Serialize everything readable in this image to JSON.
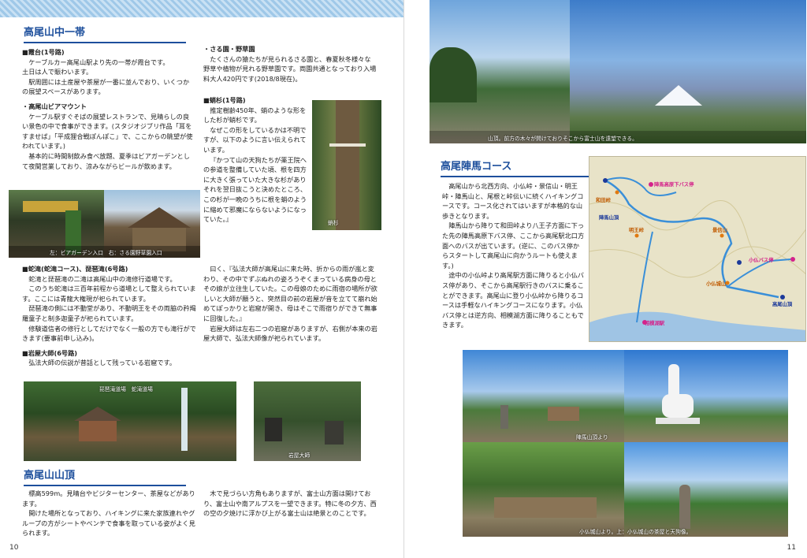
{
  "left": {
    "sec1_title": "高尾山中一帯",
    "col1": {
      "kasumi_head": "■霞台(1号路)",
      "kasumi_1": "ケーブルカー高尾山駅より先の一帯が霞台です。",
      "kasumi_2": "土日は人で賑わいます。",
      "kasumi_3": "駅周囲には土産屋や茶屋が一番に並んでおり、いくつかの展望スペースがあります。",
      "beer_head": "・高尾山ビアマウント",
      "beer_1": "ケーブル駅すぐそばの展望レストランで、見晴らしの良い景色の中で食事ができます。(スタジオジブリ作品「耳をすませば」「平成狸合戦ぽんぽこ」で、ここからの眺望が使われています。)",
      "beer_2": "基本的に時間制飲み食べ放題、夏季はビアガーデンとして夜間営業しており、涼みながらビールが飲めます。"
    },
    "col2": {
      "saru_head": "・さる園・野草園",
      "saru_1": "たくさんの猿たちが見られるさる園と、春夏秋冬様々な野草や植物が見れる野草園です。両園共通となっており入場料大人420円です(2018/8現在)。",
      "tako_head": "■蛸杉(1号路)",
      "tako_1": "推定樹齢450年、蛸のような形をした杉が蛸杉です。",
      "tako_2": "なぜこの形をしているかは不明ですが、以下のように言い伝えられています。",
      "tako_3": "『かつて山の天狗たちが薬王院への参道を整備していた頃、根を四方に大きく張っていた大きな杉がありそれを翌日抜こうと決めたところ、この杉が一晩のうちに根を蛸のように縮めて邪魔にならないようになっていた。』"
    },
    "photo_cablecar_caption": "左：ビアガーデン入口　右：さる園野草園入口",
    "photo_tree_caption": "蛸杉",
    "col3": {
      "jaja_head": "■蛇滝(蛇滝コース)、琵琶滝(6号路)",
      "jaja_1": "蛇滝と琵琶滝の二滝は高尾山中の滝修行道場です。",
      "jaja_2": "このうち蛇滝は三百年前程から道場として整えられています。ここには青龍大権現が祀られています。",
      "jaja_3": "琵琶滝の側には不動堂があり、不動明王をその両脇の矜羯羅童子と制多迦童子が祀られています。",
      "jaja_4": "修験道信者の修行としてだけでなく一般の方でも滝行ができます(要事前申し込み)。",
      "iwaya_head": "■岩屋大師(6号路)",
      "iwaya_1": "弘法大師の伝説が昔話として残っている岩窟です。"
    },
    "col4": {
      "legend_1": "曰く、『弘法大師が高尾山に来た時、折からの雨が嵐と変わり、その中でずぶぬれの姿ろうぞくまっている病身の母とその娘が立往生していた。この母娘のために雨宿の場所が欲しいと大師が願うと、突然目の前の岩屋が音を立てて崩れ始めてぽっかりと岩窟が開き、母はそこで雨宿りができて無事に回復した。』",
      "legend_2": "岩屋大師は左右二つの岩窟がありますが、右側が本来の岩屋大師で、弘法大師像が祀られています。"
    },
    "photo_temple_caption": "琵琶滝道場　蛇滝道場",
    "photo_cave_caption": "岩屋大師",
    "sec2_title": "高尾山山頂",
    "col5": {
      "summit_1": "標高599m。見晴台やビジターセンター、茶屋などがあります。",
      "summit_2": "開けた場所となっており、ハイキングに来た家族連れやグループの方がシートやベンチで食事を取っている姿がよく見られます。"
    },
    "col6": {
      "summit_3": "木で見づらい方角もありますが、富士山方面は開けており、富士山や南アルプスを一望できます。特に冬の夕方、西の空の夕焼けに浮かび上がる富士山は絶景とのことです。"
    },
    "page_number": "10"
  },
  "right": {
    "photo_top_caption": "山頂。前方の木々が開けておりそこから富士山を遠望できる。",
    "sec_title": "高尾陣馬コース",
    "col": {
      "p1": "高尾山から北西方向、小仏峠・景信山・明王峠・陣馬山と、尾根と峠伝いに続くハイキングコースです。コース化されてはいますが本格的な山歩きとなります。",
      "p2": "陣馬山から降りて和田峠より八王子方面に下った先の陣馬高原下バス停、ここから高尾駅北口方面へのバスが出ています。(逆に、このバス停からスタートして高尾山に向かうルートも使えます。)",
      "p3": "途中の小仏峠より高尾駅方面に降りると小仏バス停があり、そこから高尾駅行きのバスに乗ることができます。高尾山に登り小仏峠から降りるコースは手軽なハイキングコースになります。小仏バス停とは逆方向、相模湖方面に降りることもできます。"
    },
    "map_labels": {
      "jinbakogen": "陣馬高原下バス停",
      "wadatoge": "和田峠",
      "jinbasan": "陣馬山頂",
      "meioutoge": "明王峠",
      "kagenobu": "景信山",
      "kobotoke_bus": "小仏バス停",
      "kobototoge": "小仏峠",
      "kobotoshiroyama": "小仏城山",
      "takaosan": "高尾山頂",
      "sagamiko": "相模湖駅"
    },
    "photo_jinba_caption": "陣馬山頂より",
    "photo_tea_caption": "小仏城山より。上：小仏城山の茶屋と天狗像。",
    "page_number": "11"
  }
}
